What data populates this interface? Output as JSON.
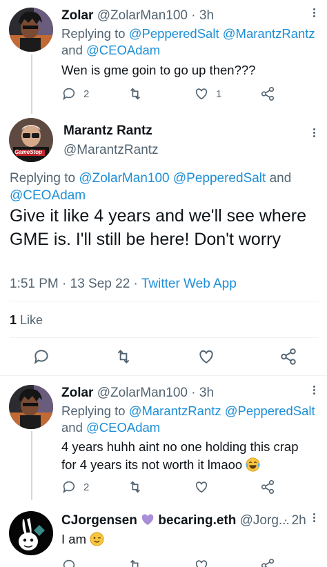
{
  "tweet1": {
    "name": "Zolar",
    "handle": "@ZolarMan100",
    "time": "· 3h",
    "replying_prefix": "Replying to ",
    "replying_mention1": "@PepperedSalt",
    "replying_mention2": "@MarantzRantz",
    "replying_and": "and ",
    "replying_mention3": "@CEOAdam",
    "text": "Wen is gme goin to go up then???",
    "reply_count": "2",
    "like_count": "1"
  },
  "focus": {
    "name": "Marantz Rantz",
    "handle": "@MarantzRantz",
    "replying_prefix": "Replying to ",
    "replying_mention1": "@ZolarMan100",
    "replying_mention2": "@PepperedSalt",
    "replying_and": " and",
    "replying_mention3": "@CEOAdam",
    "text": "Give it like 4 years and we'll see where GME is.  I'll still be here! Don't worry",
    "time": "1:51 PM · 13 Sep 22 · ",
    "source": "Twitter Web App",
    "likes_count": "1",
    "likes_label": " Like",
    "avatar_shirt_text": "GameStop"
  },
  "tweet3": {
    "name": "Zolar",
    "handle": "@ZolarMan100",
    "time": "· 3h",
    "replying_prefix": "Replying to ",
    "replying_mention1": "@MarantzRantz",
    "replying_mention2": "@PepperedSalt",
    "replying_and": "and ",
    "replying_mention3": "@CEOAdam",
    "text": "4 years huhh aint no one holding this crap for 4 years its not worth it lmaoo",
    "emoji": "😂",
    "reply_count": "2"
  },
  "tweet4": {
    "name": "CJorgensen",
    "name_suffix": " becaring.eth",
    "handle": "@Jorg...",
    "time": "· 2h",
    "text": "I am ",
    "emoji": "😉"
  },
  "colors": {
    "accent": "#1d8ed6",
    "secondary_text": "#536471",
    "primary_text": "#0f1419",
    "divider": "#eff3f4",
    "heart_purple": "#a98ed8"
  }
}
